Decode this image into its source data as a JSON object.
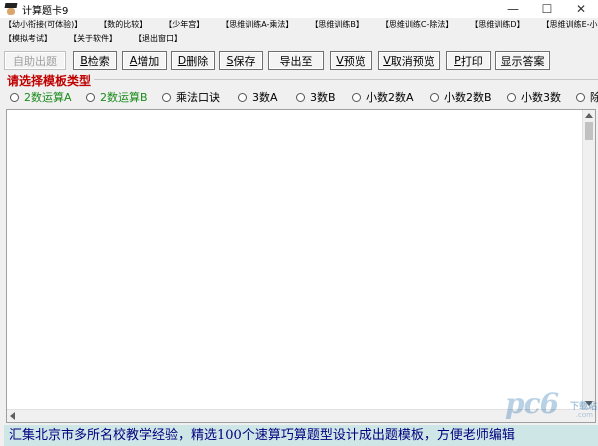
{
  "window": {
    "title": "计算题卡9",
    "controls": {
      "minimize": "—",
      "maximize": "☐",
      "close": "✕"
    }
  },
  "menu": {
    "row1": [
      "【幼小衔接(可体验)】",
      "【数的比较】",
      "【少年宫】",
      "【思维训练A-乘法】",
      "【思维训练B】",
      "【思维训练C-除法】",
      "【思维训练D】",
      "【思维训练E-小数】"
    ],
    "row2": [
      "【模拟考试】",
      "【关于软件】",
      "【退出窗口】"
    ]
  },
  "toolbar": {
    "auto": "自助出题",
    "search_key": "B",
    "search": "检索",
    "add_key": "A",
    "add": "增加",
    "delete_key": "D",
    "delete": "删除",
    "save_key": "S",
    "save": "保存",
    "export": "导出至",
    "preview_key": "V",
    "preview": "预览",
    "cancel_preview_key": "V",
    "cancel_preview": "取消预览",
    "print_key": "P",
    "print": "打印",
    "show_answer": "显示答案"
  },
  "template_group": {
    "legend": "请选择模板类型",
    "options": [
      "2数运算A",
      "2数运算B",
      "乘法口诀",
      "3数A",
      "3数B",
      "小数2数A",
      "小数2数B",
      "小数3数",
      "除"
    ]
  },
  "status": {
    "text": "汇集北京市多所名校教学经验，精选100个速算巧算题型设计成出题模板，方便老师编辑"
  },
  "watermark": {
    "main": "pc6",
    "sub": "下载站",
    "domain": ".com"
  },
  "colors": {
    "legend": "#c00000",
    "radio_green": "#1a8a1a",
    "status_bg": "#cfe6e6",
    "status_text": "#000080"
  }
}
